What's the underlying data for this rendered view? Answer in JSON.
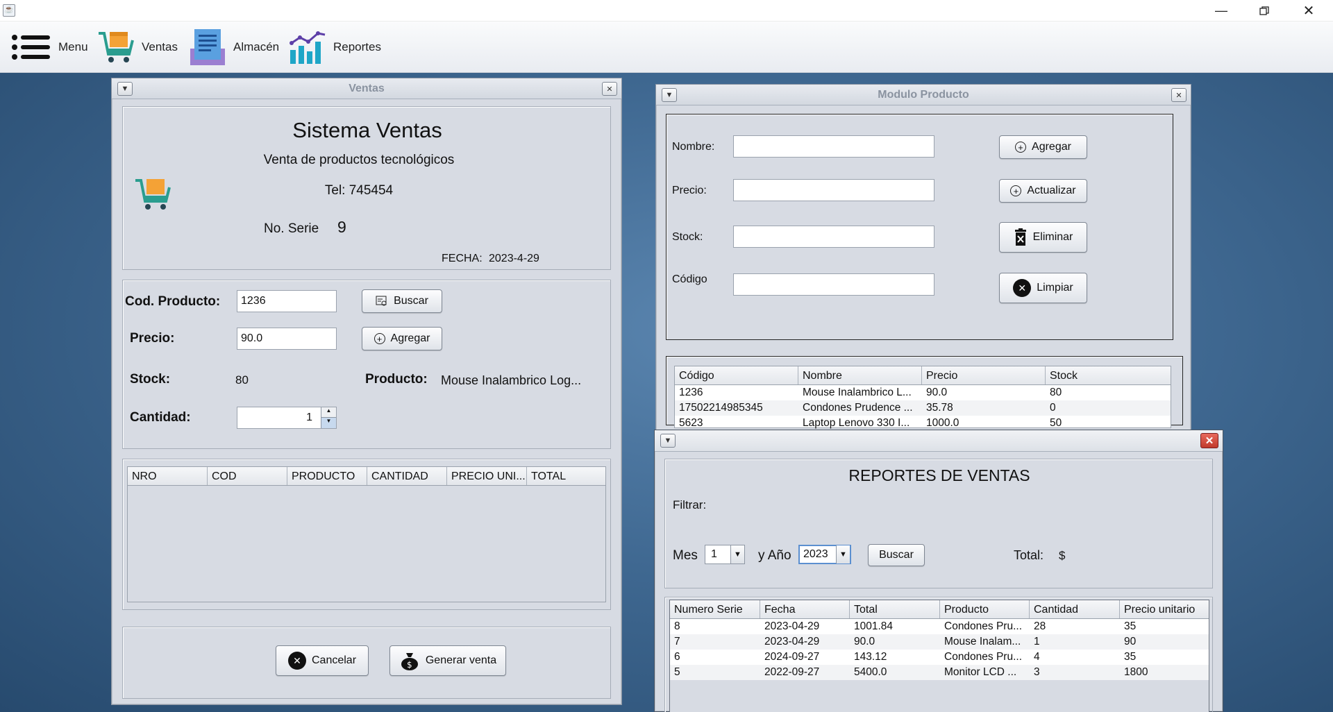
{
  "menubar": {
    "items": [
      {
        "label": "Menu",
        "icon": "menu-icon"
      },
      {
        "label": "Ventas",
        "icon": "cart-icon"
      },
      {
        "label": "Almacén",
        "icon": "warehouse-icon"
      },
      {
        "label": "Reportes",
        "icon": "chart-icon"
      }
    ]
  },
  "ventas": {
    "title": "Ventas",
    "heading": "Sistema Ventas",
    "subtitle": "Venta de productos tecnológicos",
    "tel": "Tel: 745454",
    "serie_label": "No. Serie",
    "serie_value": "9",
    "fecha_label": "FECHA:",
    "fecha_value": "2023-4-29",
    "cod_label": "Cod. Producto:",
    "cod_value": "1236",
    "buscar": "Buscar",
    "precio_label": "Precio:",
    "precio_value": "90.0",
    "agregar": "Agregar",
    "stock_label": "Stock:",
    "stock_value": "80",
    "producto_label": "Producto:",
    "producto_value": "Mouse Inalambrico Log...",
    "cantidad_label": "Cantidad:",
    "cantidad_value": "1",
    "table_headers": [
      "NRO",
      "COD",
      "PRODUCTO",
      "CANTIDAD",
      "PRECIO UNI...",
      "TOTAL"
    ],
    "cancelar": "Cancelar",
    "generar": "Generar venta"
  },
  "producto": {
    "title": "Modulo Producto",
    "nombre_label": "Nombre:",
    "precio_label": "Precio:",
    "stock_label": "Stock:",
    "codigo_label": "Código",
    "agregar": "Agregar",
    "actualizar": "Actualizar",
    "eliminar": "Eliminar",
    "limpiar": "Limpiar",
    "table_headers": [
      "Código",
      "Nombre",
      "Precio",
      "Stock"
    ],
    "rows": [
      [
        "1236",
        "Mouse Inalambrico L...",
        "90.0",
        "80"
      ],
      [
        "17502214985345",
        "Condones Prudence ...",
        "35.78",
        "0"
      ],
      [
        "5623",
        "Laptop Lenovo 330 I...",
        "1000.0",
        "50"
      ]
    ]
  },
  "reportes": {
    "heading": "REPORTES DE VENTAS",
    "filtrar": "Filtrar:",
    "mes_label": "Mes",
    "mes_value": "1",
    "anio_label": "y Año",
    "anio_value": "2023",
    "buscar": "Buscar",
    "total_label": "Total:",
    "total_value": "$",
    "table_headers": [
      "Numero Serie",
      "Fecha",
      "Total",
      "Producto",
      "Cantidad",
      "Precio unitario"
    ],
    "rows": [
      [
        "8",
        "2023-04-29",
        "1001.84",
        "Condones Pru...",
        "28",
        "35"
      ],
      [
        "7",
        "2023-04-29",
        "90.0",
        "Mouse Inalam...",
        "1",
        "90"
      ],
      [
        "6",
        "2024-09-27",
        "143.12",
        "Condones Pru...",
        "4",
        "35"
      ],
      [
        "5",
        "2022-09-27",
        "5400.0",
        "Monitor LCD ...",
        "3",
        "1800"
      ]
    ]
  }
}
